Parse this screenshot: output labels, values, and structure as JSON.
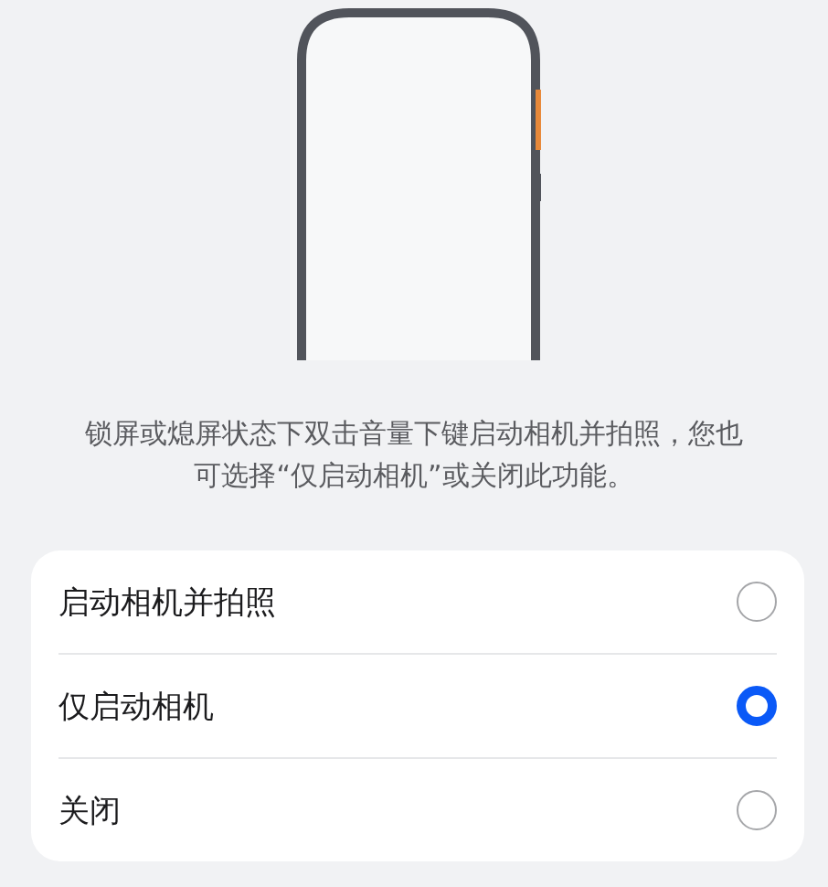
{
  "description": "锁屏或熄屏状态下双击音量下键启动相机并拍照，您也可选择“仅启动相机”或关闭此功能。",
  "options": [
    {
      "label": "启动相机并拍照",
      "selected": false
    },
    {
      "label": "仅启动相机",
      "selected": true
    },
    {
      "label": "关闭",
      "selected": false
    }
  ]
}
